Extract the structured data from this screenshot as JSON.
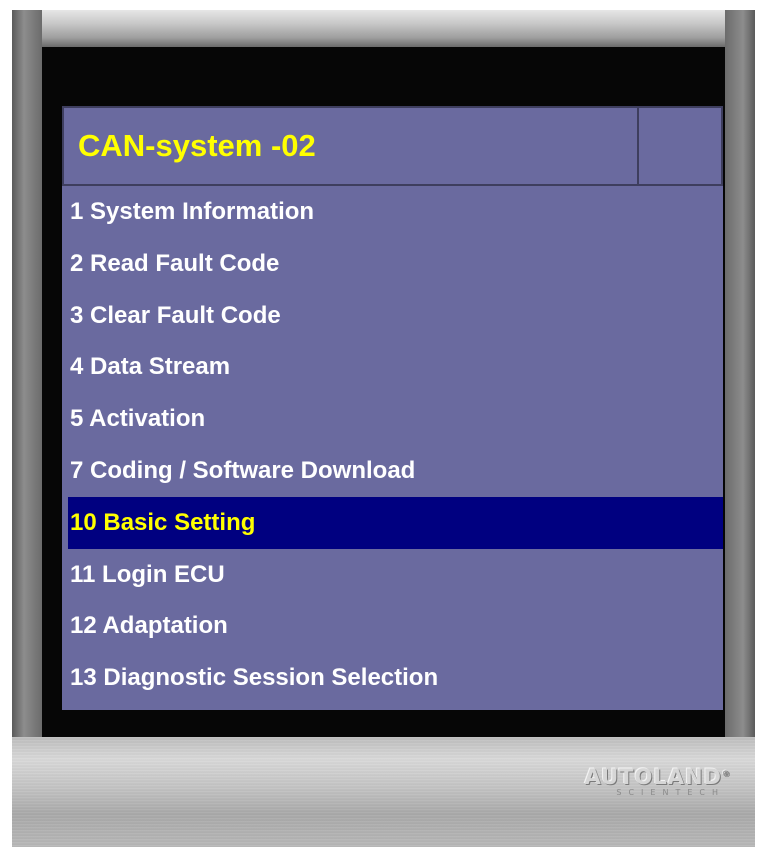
{
  "title": "CAN-system -02",
  "menu": [
    {
      "label": "1 System Information",
      "selected": false
    },
    {
      "label": "2 Read Fault Code",
      "selected": false
    },
    {
      "label": "3 Clear Fault Code",
      "selected": false
    },
    {
      "label": "4 Data Stream",
      "selected": false
    },
    {
      "label": "5 Activation",
      "selected": false
    },
    {
      "label": "7 Coding / Software Download",
      "selected": false
    },
    {
      "label": "10 Basic Setting",
      "selected": true
    },
    {
      "label": "11 Login ECU",
      "selected": false
    },
    {
      "label": "12 Adaptation",
      "selected": false
    },
    {
      "label": "13 Diagnostic Session Selection",
      "selected": false
    }
  ],
  "brand": {
    "name": "AUTOLAND",
    "tagline": "SCIENTECH"
  },
  "colors": {
    "panel_bg": "#6a6a9f",
    "selected_bg": "#000080",
    "title_text": "#ffff00",
    "item_text": "#ffffff",
    "selected_text": "#ffff00"
  }
}
